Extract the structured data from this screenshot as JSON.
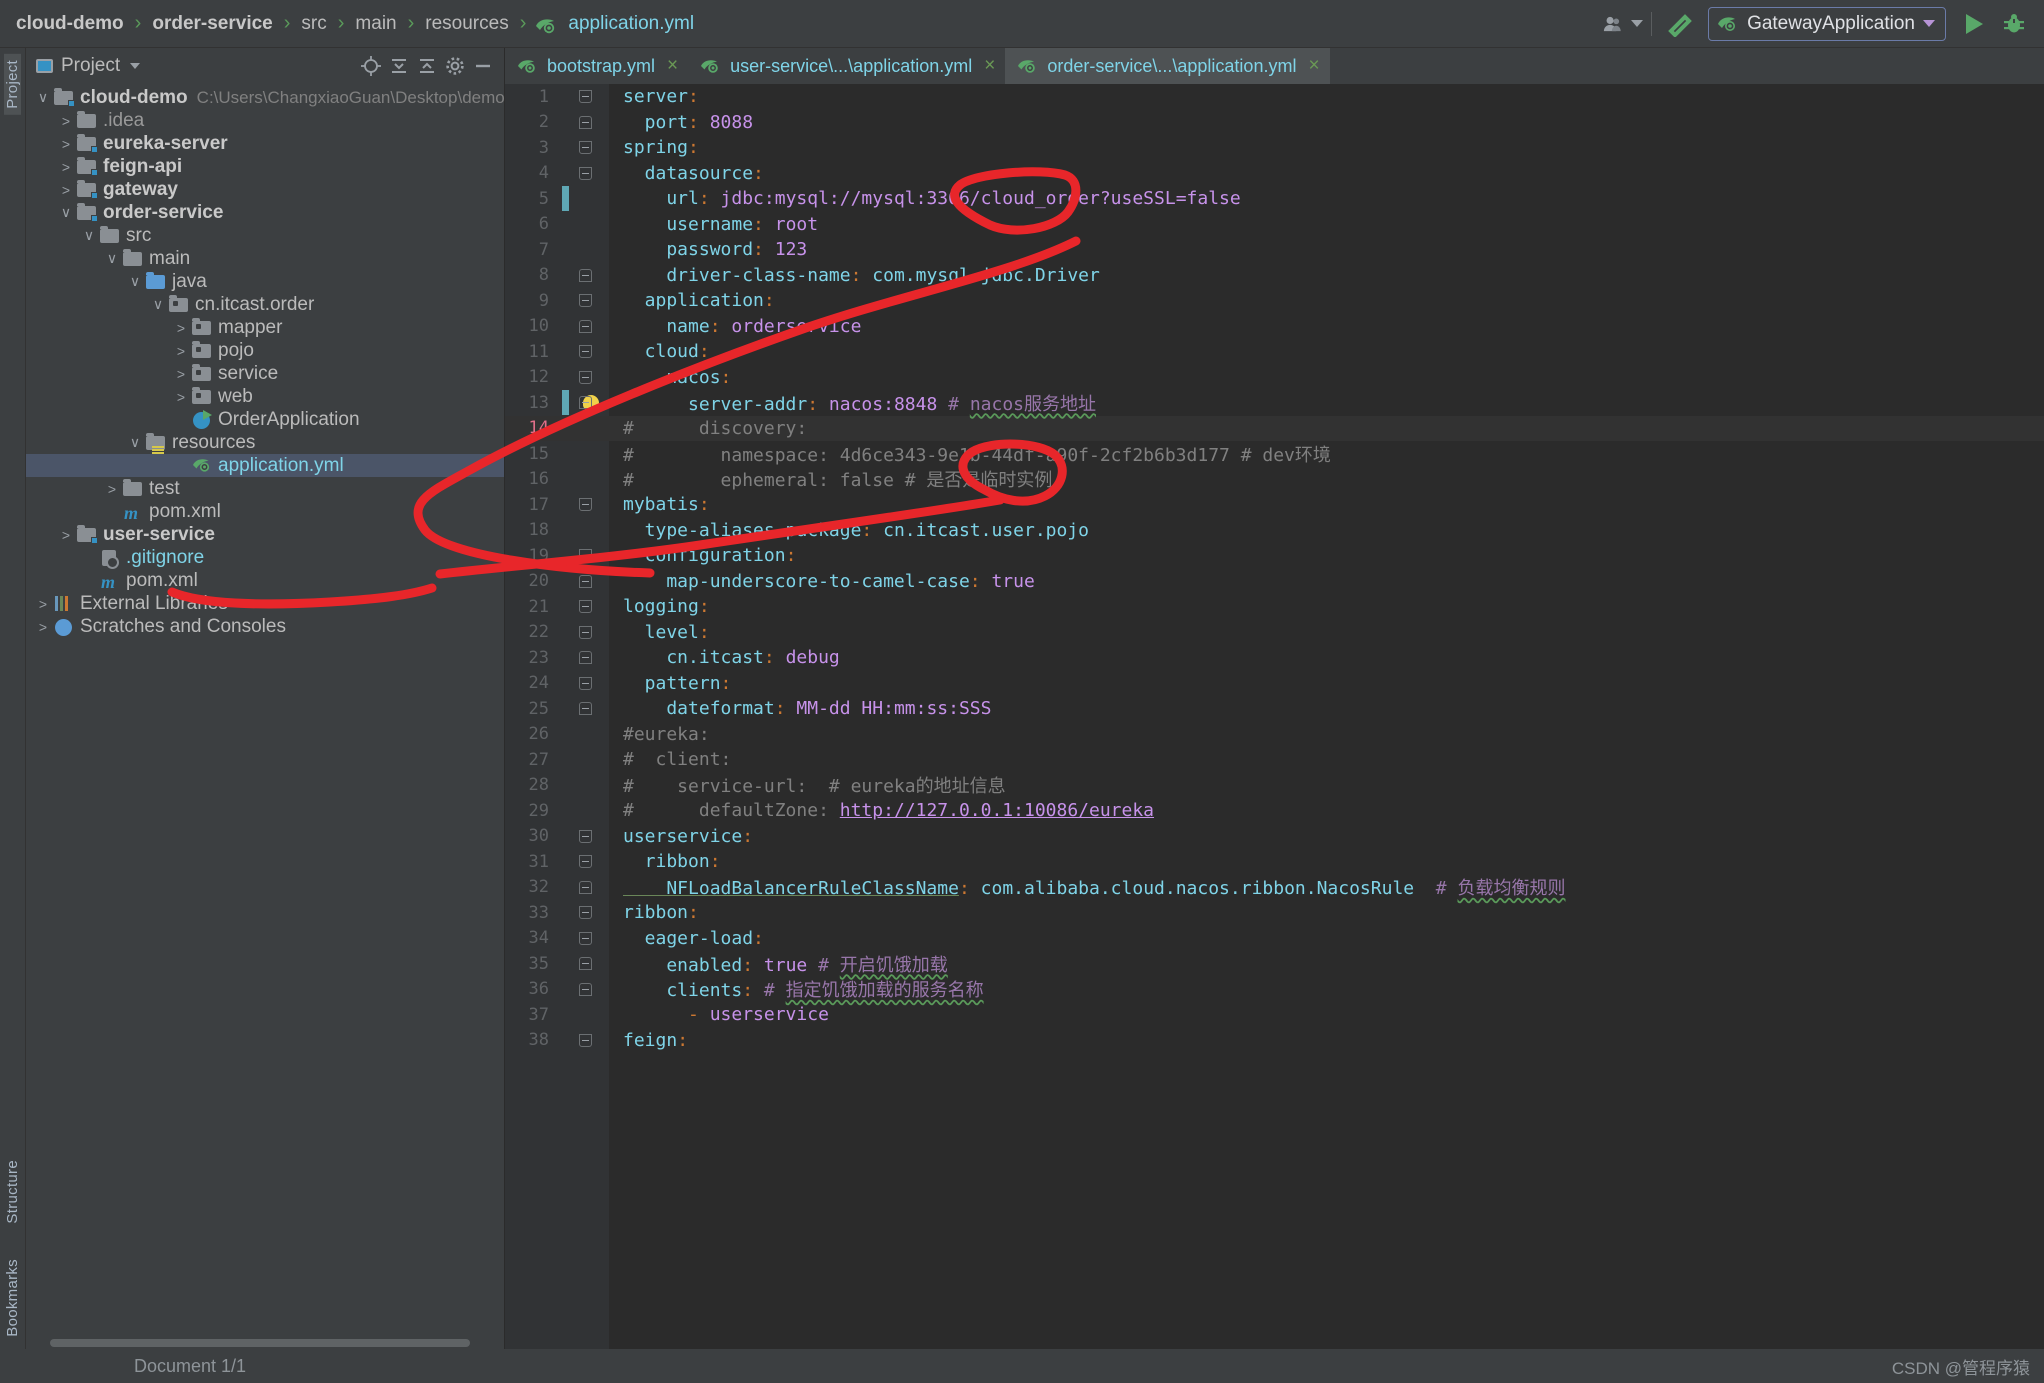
{
  "app": {
    "ide": "IntelliJ IDEA",
    "breadcrumb": [
      {
        "label": "cloud-demo",
        "style": "bold"
      },
      {
        "label": "order-service",
        "style": "bold"
      },
      {
        "label": "src",
        "style": "plain"
      },
      {
        "label": "main",
        "style": "plain"
      },
      {
        "label": "resources",
        "style": "plain"
      },
      {
        "label": "application.yml",
        "style": "file"
      }
    ],
    "breadcrumb_separator": "›"
  },
  "toolbar": {
    "account_icon": "user-avatar-icon",
    "account_caret": "chevron-down-icon",
    "build_icon": "hammer-icon",
    "run_config_name": "GatewayApplication",
    "run_config_icon": "spring-leaf-icon",
    "run_config_caret": "chevron-down-icon",
    "run_icon": "play-icon",
    "debug_icon": "bug-icon"
  },
  "left_strip": {
    "top_tab": "Project",
    "bottom_tabs": [
      "Structure",
      "Bookmarks"
    ]
  },
  "project_panel": {
    "title": "Project",
    "title_caret": "chevron-down-icon",
    "tools": [
      "locate-icon",
      "collapse-all-icon",
      "expand-icon",
      "gear-icon",
      "hide-icon"
    ],
    "tree": [
      {
        "depth": 0,
        "arrow": "down",
        "icon": "module-folder",
        "label": "cloud-demo",
        "style": "bold",
        "path": "C:\\Users\\ChangxiaoGuan\\Desktop\\demo\\compose\\cl"
      },
      {
        "depth": 1,
        "arrow": "right",
        "icon": "folder",
        "label": ".idea",
        "style": "grey"
      },
      {
        "depth": 1,
        "arrow": "right",
        "icon": "module-folder",
        "label": "eureka-server",
        "style": "bold"
      },
      {
        "depth": 1,
        "arrow": "right",
        "icon": "module-folder",
        "label": "feign-api",
        "style": "bold"
      },
      {
        "depth": 1,
        "arrow": "right",
        "icon": "module-folder",
        "label": "gateway",
        "style": "bold"
      },
      {
        "depth": 1,
        "arrow": "down",
        "icon": "module-folder",
        "label": "order-service",
        "style": "bold"
      },
      {
        "depth": 2,
        "arrow": "down",
        "icon": "folder",
        "label": "src",
        "style": "plain"
      },
      {
        "depth": 3,
        "arrow": "down",
        "icon": "folder",
        "label": "main",
        "style": "plain"
      },
      {
        "depth": 4,
        "arrow": "down",
        "icon": "source-folder",
        "label": "java",
        "style": "plain"
      },
      {
        "depth": 5,
        "arrow": "down",
        "icon": "package",
        "label": "cn.itcast.order",
        "style": "plain"
      },
      {
        "depth": 6,
        "arrow": "right",
        "icon": "package",
        "label": "mapper",
        "style": "plain"
      },
      {
        "depth": 6,
        "arrow": "right",
        "icon": "package",
        "label": "pojo",
        "style": "plain"
      },
      {
        "depth": 6,
        "arrow": "right",
        "icon": "package",
        "label": "service",
        "style": "plain"
      },
      {
        "depth": 6,
        "arrow": "right",
        "icon": "package",
        "label": "web",
        "style": "plain"
      },
      {
        "depth": 6,
        "arrow": "none",
        "icon": "spring-class",
        "label": "OrderApplication",
        "style": "plain"
      },
      {
        "depth": 4,
        "arrow": "down",
        "icon": "resource-folder",
        "label": "resources",
        "style": "plain"
      },
      {
        "depth": 6,
        "arrow": "none",
        "icon": "spring-yaml",
        "label": "application.yml",
        "style": "link",
        "selected": true
      },
      {
        "depth": 3,
        "arrow": "right",
        "icon": "folder",
        "label": "test",
        "style": "plain"
      },
      {
        "depth": 3,
        "arrow": "none",
        "icon": "maven",
        "label": "pom.xml",
        "style": "plain"
      },
      {
        "depth": 1,
        "arrow": "right",
        "icon": "module-folder",
        "label": "user-service",
        "style": "bold"
      },
      {
        "depth": 2,
        "arrow": "none",
        "icon": "gitignore",
        "label": ".gitignore",
        "style": "link"
      },
      {
        "depth": 2,
        "arrow": "none",
        "icon": "maven",
        "label": "pom.xml",
        "style": "plain"
      },
      {
        "depth": 0,
        "arrow": "right",
        "icon": "libraries",
        "label": "External Libraries",
        "style": "plain"
      },
      {
        "depth": 0,
        "arrow": "right",
        "icon": "scratches",
        "label": "Scratches and Consoles",
        "style": "plain"
      }
    ]
  },
  "editor": {
    "tabs": [
      {
        "label": "bootstrap.yml",
        "icon": "spring-leaf-icon",
        "active": false,
        "close": "×"
      },
      {
        "label": "user-service\\...\\application.yml",
        "icon": "spring-yaml-icon",
        "active": false,
        "close": "×"
      },
      {
        "label": "order-service\\...\\application.yml",
        "icon": "spring-yaml-icon",
        "active": true,
        "close": "×"
      }
    ],
    "current_line": 14,
    "lines": [
      {
        "n": 1,
        "fold": "start",
        "indent": 0,
        "tokens": [
          {
            "t": "server",
            "c": "k"
          },
          {
            "t": ":",
            "c": "p"
          }
        ]
      },
      {
        "n": 2,
        "fold": "end",
        "indent": 1,
        "tokens": [
          {
            "t": "  port",
            "c": "k"
          },
          {
            "t": ": ",
            "c": "p"
          },
          {
            "t": "8088",
            "c": "v"
          }
        ]
      },
      {
        "n": 3,
        "fold": "start",
        "indent": 0,
        "tokens": [
          {
            "t": "spring",
            "c": "k"
          },
          {
            "t": ":",
            "c": "p"
          }
        ]
      },
      {
        "n": 4,
        "fold": "start",
        "indent": 1,
        "tokens": [
          {
            "t": "  datasource",
            "c": "k"
          },
          {
            "t": ":",
            "c": "p"
          }
        ]
      },
      {
        "n": 5,
        "fold": "none",
        "indent": 2,
        "changed": true,
        "tokens": [
          {
            "t": "    url",
            "c": "k"
          },
          {
            "t": ": ",
            "c": "p"
          },
          {
            "t": "jdbc:mysql://mysql:3306/cloud_order?useSSL=false",
            "c": "v"
          }
        ]
      },
      {
        "n": 6,
        "fold": "none",
        "indent": 2,
        "tokens": [
          {
            "t": "    username",
            "c": "k"
          },
          {
            "t": ": ",
            "c": "p"
          },
          {
            "t": "root",
            "c": "v"
          }
        ]
      },
      {
        "n": 7,
        "fold": "none",
        "indent": 2,
        "tokens": [
          {
            "t": "    password",
            "c": "k"
          },
          {
            "t": ": ",
            "c": "p"
          },
          {
            "t": "123",
            "c": "v"
          }
        ]
      },
      {
        "n": 8,
        "fold": "end",
        "indent": 2,
        "tokens": [
          {
            "t": "    driver-class-name",
            "c": "k"
          },
          {
            "t": ": ",
            "c": "p"
          },
          {
            "t": "com.mysql.jdbc.Driver",
            "c": "k"
          }
        ]
      },
      {
        "n": 9,
        "fold": "start",
        "indent": 1,
        "tokens": [
          {
            "t": "  application",
            "c": "k"
          },
          {
            "t": ":",
            "c": "p"
          }
        ]
      },
      {
        "n": 10,
        "fold": "end",
        "indent": 2,
        "tokens": [
          {
            "t": "    name",
            "c": "k"
          },
          {
            "t": ": ",
            "c": "p"
          },
          {
            "t": "orderservice",
            "c": "v"
          }
        ]
      },
      {
        "n": 11,
        "fold": "start",
        "indent": 1,
        "tokens": [
          {
            "t": "  cloud",
            "c": "k"
          },
          {
            "t": ":",
            "c": "p"
          }
        ]
      },
      {
        "n": 12,
        "fold": "start",
        "indent": 2,
        "tokens": [
          {
            "t": "    nacos",
            "c": "k"
          },
          {
            "t": ":",
            "c": "p"
          }
        ]
      },
      {
        "n": 13,
        "fold": "end",
        "indent": 3,
        "changed": true,
        "bulb": true,
        "tokens": [
          {
            "t": "      server-addr",
            "c": "k"
          },
          {
            "t": ": ",
            "c": "p"
          },
          {
            "t": "nacos:8848",
            "c": "v"
          },
          {
            "t": " # ",
            "c": "cmb"
          },
          {
            "t": "nacos服务地址",
            "c": "cmb"
          }
        ]
      },
      {
        "n": 14,
        "fold": "none",
        "indent": 0,
        "highlight": true,
        "tokens": [
          {
            "t": "#      discovery:",
            "c": "cm"
          }
        ]
      },
      {
        "n": 15,
        "fold": "none",
        "indent": 0,
        "tokens": [
          {
            "t": "#        namespace: 4d6ce343-9e1b-44df-a90f-2cf2b6b3d177 # dev环境",
            "c": "cm"
          }
        ]
      },
      {
        "n": 16,
        "fold": "none",
        "indent": 0,
        "tokens": [
          {
            "t": "#        ephemeral: false # 是否是临时实例",
            "c": "cm"
          }
        ]
      },
      {
        "n": 17,
        "fold": "start",
        "indent": 0,
        "tokens": [
          {
            "t": "mybatis",
            "c": "k"
          },
          {
            "t": ":",
            "c": "p"
          }
        ]
      },
      {
        "n": 18,
        "fold": "none",
        "indent": 1,
        "tokens": [
          {
            "t": "  type-aliases-package",
            "c": "k"
          },
          {
            "t": ": ",
            "c": "p"
          },
          {
            "t": "cn.itcast.user.pojo",
            "c": "k"
          }
        ]
      },
      {
        "n": 19,
        "fold": "start",
        "indent": 1,
        "tokens": [
          {
            "t": "  configuration",
            "c": "k"
          },
          {
            "t": ":",
            "c": "p"
          }
        ]
      },
      {
        "n": 20,
        "fold": "end",
        "indent": 2,
        "tokens": [
          {
            "t": "    map-underscore-to-camel-case",
            "c": "k"
          },
          {
            "t": ": ",
            "c": "p"
          },
          {
            "t": "true",
            "c": "tru"
          }
        ]
      },
      {
        "n": 21,
        "fold": "start",
        "indent": 0,
        "tokens": [
          {
            "t": "logging",
            "c": "k"
          },
          {
            "t": ":",
            "c": "p"
          }
        ]
      },
      {
        "n": 22,
        "fold": "start",
        "indent": 1,
        "tokens": [
          {
            "t": "  level",
            "c": "k"
          },
          {
            "t": ":",
            "c": "p"
          }
        ]
      },
      {
        "n": 23,
        "fold": "end",
        "indent": 2,
        "tokens": [
          {
            "t": "    cn.itcast",
            "c": "k"
          },
          {
            "t": ": ",
            "c": "p"
          },
          {
            "t": "debug",
            "c": "v"
          }
        ]
      },
      {
        "n": 24,
        "fold": "start",
        "indent": 1,
        "tokens": [
          {
            "t": "  pattern",
            "c": "k"
          },
          {
            "t": ":",
            "c": "p"
          }
        ]
      },
      {
        "n": 25,
        "fold": "end",
        "indent": 2,
        "tokens": [
          {
            "t": "    dateformat",
            "c": "k"
          },
          {
            "t": ": ",
            "c": "p"
          },
          {
            "t": "MM-dd HH:mm:ss:SSS",
            "c": "v"
          }
        ]
      },
      {
        "n": 26,
        "fold": "none",
        "indent": 0,
        "tokens": [
          {
            "t": "#eureka:",
            "c": "cm"
          }
        ]
      },
      {
        "n": 27,
        "fold": "none",
        "indent": 0,
        "tokens": [
          {
            "t": "#  client:",
            "c": "cm"
          }
        ]
      },
      {
        "n": 28,
        "fold": "none",
        "indent": 0,
        "tokens": [
          {
            "t": "#    service-url:  # eureka的地址信息",
            "c": "cm"
          }
        ]
      },
      {
        "n": 29,
        "fold": "none",
        "indent": 0,
        "tokens": [
          {
            "t": "#      defaultZone: ",
            "c": "cm"
          },
          {
            "t": "http://127.0.0.1:10086/eureka",
            "c": "url"
          }
        ]
      },
      {
        "n": 30,
        "fold": "start",
        "indent": 0,
        "tokens": [
          {
            "t": "userservice",
            "c": "k"
          },
          {
            "t": ":",
            "c": "p"
          }
        ]
      },
      {
        "n": 31,
        "fold": "start",
        "indent": 1,
        "tokens": [
          {
            "t": "  ribbon",
            "c": "k"
          },
          {
            "t": ":",
            "c": "p"
          }
        ]
      },
      {
        "n": 32,
        "fold": "end",
        "indent": 2,
        "tokens": [
          {
            "t": "    NFLoadBalancerRuleClassName",
            "c": "kw"
          },
          {
            "t": ": ",
            "c": "p"
          },
          {
            "t": "com.alibaba.cloud.nacos.ribbon.NacosRule",
            "c": "k"
          },
          {
            "t": "  # ",
            "c": "cmb"
          },
          {
            "t": "负载均衡规则",
            "c": "cmb"
          }
        ]
      },
      {
        "n": 33,
        "fold": "start",
        "indent": 0,
        "tokens": [
          {
            "t": "ribbon",
            "c": "k"
          },
          {
            "t": ":",
            "c": "p"
          }
        ]
      },
      {
        "n": 34,
        "fold": "start",
        "indent": 1,
        "tokens": [
          {
            "t": "  eager-load",
            "c": "k"
          },
          {
            "t": ":",
            "c": "p"
          }
        ]
      },
      {
        "n": 35,
        "fold": "end",
        "indent": 2,
        "tokens": [
          {
            "t": "    enabled",
            "c": "k"
          },
          {
            "t": ": ",
            "c": "p"
          },
          {
            "t": "true",
            "c": "tru"
          },
          {
            "t": " # ",
            "c": "cmb"
          },
          {
            "t": "开启饥饿加载",
            "c": "cmb"
          }
        ]
      },
      {
        "n": 36,
        "fold": "end",
        "indent": 2,
        "tokens": [
          {
            "t": "    clients",
            "c": "k"
          },
          {
            "t": ": ",
            "c": "p"
          },
          {
            "t": "# ",
            "c": "cmb"
          },
          {
            "t": "指定饥饿加载的服务名称",
            "c": "cmb"
          }
        ]
      },
      {
        "n": 37,
        "fold": "none",
        "indent": 3,
        "tokens": [
          {
            "t": "      - ",
            "c": "p"
          },
          {
            "t": "userservice",
            "c": "v"
          }
        ]
      },
      {
        "n": 38,
        "fold": "start",
        "indent": 0,
        "tokens": [
          {
            "t": "feign",
            "c": "k"
          },
          {
            "t": ":",
            "c": "p"
          }
        ]
      }
    ]
  },
  "status_bar": {
    "document": "Document 1/1",
    "watermark": "CSDN @管程序猿"
  },
  "annotations": {
    "color": "#e8262a",
    "shapes": [
      {
        "name": "ellipse-mysql-host",
        "type": "ellipse"
      },
      {
        "name": "ellipse-nacos-host",
        "type": "ellipse"
      },
      {
        "name": "arrow-to-application-yml",
        "type": "polyline"
      },
      {
        "name": "underline-application-yml",
        "type": "polyline"
      }
    ]
  },
  "colors": {
    "editor_bg": "#2b2b2b",
    "panel_bg": "#3c3f41",
    "accent_green": "#59a869",
    "accent_blue": "#3592c4",
    "selection": "#4b5568",
    "annotation_red": "#e8262a"
  }
}
